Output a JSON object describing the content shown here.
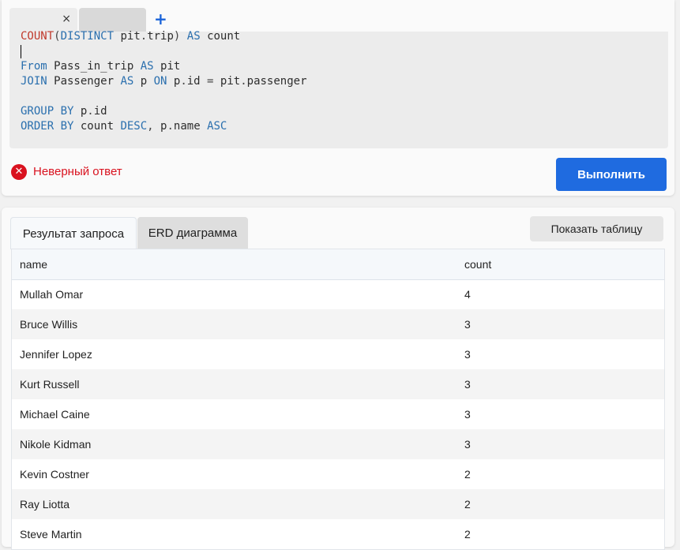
{
  "editor": {
    "tabs": [
      {
        "label": "",
        "close_icon": "×"
      },
      {
        "label": ""
      }
    ],
    "add_tab_icon": "+",
    "code": {
      "line1": {
        "fn1": "COUNT",
        "p1": "(",
        "kw1": "DISTINCT",
        "t1": " pit",
        "o1": ".",
        "t2": "trip",
        "p2": ")",
        "s1": " ",
        "kw2": "AS",
        "t3": " count"
      },
      "line3": {
        "kw1": "From",
        "t1": " Pass_in_trip ",
        "kw2": "AS",
        "t2": " pit"
      },
      "line4": {
        "kw1": "JOIN",
        "t1": " Passenger ",
        "kw2": "AS",
        "t2": " p ",
        "kw3": "ON",
        "t3": " p",
        "o1": ".",
        "t4": "id ",
        "o2": "=",
        "t5": " pit",
        "o3": ".",
        "t6": "passenger"
      },
      "line6": {
        "kw1": "GROUP BY",
        "t1": " p",
        "o1": ".",
        "t2": "id"
      },
      "line7": {
        "kw1": "ORDER BY",
        "t1": " count ",
        "kw2": "DESC",
        "o1": ",",
        "t2": " p",
        "o2": ".",
        "t3": "name ",
        "kw3": "ASC"
      }
    },
    "status_text": "Неверный ответ",
    "run_label": "Выполнить"
  },
  "results": {
    "tabs": [
      "Результат запроса",
      "ERD диаграмма"
    ],
    "show_table_label": "Показать таблицу",
    "columns": [
      "name",
      "count"
    ],
    "rows": [
      [
        "Mullah Omar",
        "4"
      ],
      [
        "Bruce Willis",
        "3"
      ],
      [
        "Jennifer Lopez",
        "3"
      ],
      [
        "Kurt Russell",
        "3"
      ],
      [
        "Michael Caine",
        "3"
      ],
      [
        "Nikole Kidman",
        "3"
      ],
      [
        "Kevin Costner",
        "2"
      ],
      [
        "Ray Liotta",
        "2"
      ],
      [
        "Steve Martin",
        "2"
      ]
    ]
  },
  "colors": {
    "accent": "#1f6be0",
    "error": "#d9121f",
    "keyword": "#2a6fae",
    "function": "#c0392b"
  },
  "icons": {
    "error": "error-icon",
    "close": "close-icon",
    "add": "plus-icon"
  }
}
